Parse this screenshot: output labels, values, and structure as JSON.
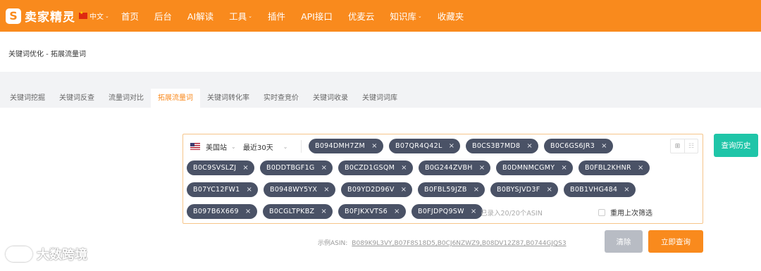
{
  "brand": {
    "logo_letter": "S",
    "name": "卖家精灵"
  },
  "language": {
    "label": "中文",
    "caret": "⌄"
  },
  "nav": [
    {
      "label": "首页",
      "dropdown": false
    },
    {
      "label": "后台",
      "dropdown": false
    },
    {
      "label": "AI解读",
      "dropdown": false
    },
    {
      "label": "工具",
      "dropdown": true
    },
    {
      "label": "插件",
      "dropdown": false
    },
    {
      "label": "API接口",
      "dropdown": false
    },
    {
      "label": "优麦云",
      "dropdown": false
    },
    {
      "label": "知识库",
      "dropdown": true
    },
    {
      "label": "收藏夹",
      "dropdown": false
    }
  ],
  "breadcrumb": "关键词优化 - 拓展流量词",
  "tabs": [
    {
      "label": "关键词挖掘",
      "active": false
    },
    {
      "label": "关键词反查",
      "active": false
    },
    {
      "label": "流量词对比",
      "active": false
    },
    {
      "label": "拓展流量词",
      "active": true
    },
    {
      "label": "关键词转化率",
      "active": false
    },
    {
      "label": "实时查竞价",
      "active": false
    },
    {
      "label": "关键词收录",
      "active": false
    },
    {
      "label": "关键词词库",
      "active": false
    }
  ],
  "query": {
    "marketplace": "美国站",
    "date_range": "最近30天",
    "asins": [
      "B094DMH7ZM",
      "B07QR4Q42L",
      "B0CS3B7MD8",
      "B0C6GS6JR3",
      "B0C9SVSLZJ",
      "B0DDTBGF1G",
      "B0CZD1GSQM",
      "B0G244ZVBH",
      "B0DMNMCGMY",
      "B0FBL2KHNR",
      "B07YC12FW1",
      "B0948WY5YX",
      "B09YD2D96V",
      "B0FBL59JZB",
      "B0BYSJVD3F",
      "B0B1VHG484",
      "B097B6X669",
      "B0CGLTPKBZ",
      "B0FJKXVTS6",
      "B0FJDPQ9SW"
    ],
    "tag_remove_glyph": "×",
    "count_text": "已录入20/20个ASIN",
    "reuse_filter_label": "重用上次筛选",
    "reuse_filter_checked": false
  },
  "history_button": "查询历史",
  "example": {
    "label": "示例ASIN:",
    "value": "B089K9L3VY,B07F8S18D5,B0CJ6NZWZ9,B08DV12Z87,B0744GJQS3"
  },
  "clear_button": "清除",
  "submit_button": "立即查询",
  "watermark": "大数跨境",
  "colors": {
    "brand": "#f98a1d",
    "teal": "#1fc5a8",
    "tag": "#4a5266",
    "clear": "#b8bcc4"
  }
}
